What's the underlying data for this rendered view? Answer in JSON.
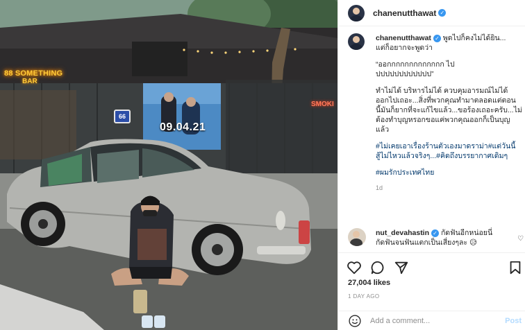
{
  "photo": {
    "bar_sign_line1": "88 SOMETHING",
    "bar_sign_line2": "BAR",
    "poster_date": "09.04.21",
    "smoking_sign": "SMOKI",
    "route_sign": "66"
  },
  "post": {
    "author": "chanenutthawat",
    "caption_lines": [
      "พูดไปก็คงไม่ได้ยิน...",
      "แต่ก็อยากจะพูดว่า",
      "",
      "“ออกกกกกกกกกกกกก ไป",
      "ปปปปปปปปปปปป”",
      "",
      "ทำไม่ได้ บริหารไม่ได้ ควบคุมอารมณ์ไม่ได้",
      "ออกไปเถอะ...สิ่งที่พวกคุณทำมาตลอดแต่ตอน",
      "นี้มันก็ยากที่จะแก้ไขแล้ว...ขอร้องเถอะครับ...ไม่",
      "ต้องทำบุญหรอกขอแค่พวกคุณออกก็เป็นบุญ",
      "แล้ว"
    ],
    "hashtag_lines": [
      "#ไม่เคยเอาเรื่องร้านตัวเองมาดราม่า#แต่วันนี้",
      "สู้ไม่ไหวแล้วจริงๆ...#คิดถึงบรรยากาศเดิมๆ"
    ],
    "hashtag_last": "#ผมรักประเทศไทย",
    "time_ago": "1d"
  },
  "comment": {
    "author": "nut_devahastin",
    "text_line1": "กัดฟันอีกหน่อยนี่",
    "text_line2": "กัดฟันจนฟันแตกเป็นเสี่ยงๆละ 😥"
  },
  "likes": "27,004 likes",
  "date": "1 DAY AGO",
  "add_comment": {
    "placeholder": "Add a comment...",
    "post_label": "Post"
  },
  "icons": {
    "verified": "verified-badge-icon",
    "like": "heart-icon",
    "comment": "comment-bubble-icon",
    "share": "paper-plane-icon",
    "save": "bookmark-icon",
    "emoji": "smiley-icon"
  },
  "colors": {
    "verified": "#3897f0",
    "hashtag": "#00376b",
    "muted": "#8e8e8e",
    "post_button": "#b3dbff"
  }
}
